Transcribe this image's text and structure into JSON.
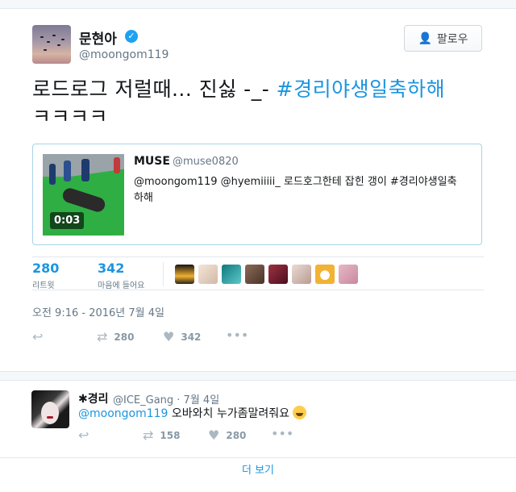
{
  "tweet": {
    "author_name": "문현아",
    "author_handle": "@moongom119",
    "follow_label": "팔로우",
    "text_before": "로드로그 저럴때... 진싫 -_- ",
    "hashtag": "#경리야생일축하해",
    "text_after": "ㅋㅋㅋㅋ",
    "timestamp": "오전 9:16 - 2016년 7월 4일",
    "retweets": "280",
    "retweets_label": "리트윗",
    "likes": "342",
    "likes_label": "마음에 들어요",
    "action_retweets": "280",
    "action_likes": "342"
  },
  "quoted": {
    "name": "MUSE",
    "handle": "@muse0820",
    "text": "@moongom119 @hyemiiiii_ 로드호그한테 잡힌 갱이 #경리야생일축하해",
    "video_duration": "0:03"
  },
  "reply": {
    "name": "✱경리",
    "handle_time": "@ICE_Gang · 7월 4일",
    "mention": "@moongom119",
    "text": " 오바와치 누가좀말려줘요 ",
    "retweets": "158",
    "likes": "280"
  },
  "more_label": "더 보기",
  "colors": {
    "link": "#1b95e0",
    "verified": "#1da1f2",
    "muted": "#657786"
  },
  "liker_avatar_colors": [
    "#2b2218",
    "#e9d7c6",
    "#1e8c93",
    "#7a5a48",
    "#8a2d3c",
    "#d9c8c2",
    "#f2b233",
    "#d9a7b8"
  ]
}
